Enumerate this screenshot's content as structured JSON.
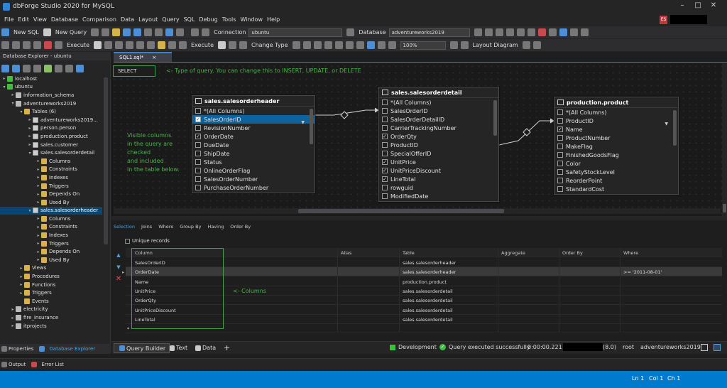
{
  "window": {
    "title": "dbForge Studio 2020 for MySQL",
    "user_badge": "ES"
  },
  "menu": [
    "File",
    "Edit",
    "View",
    "Database",
    "Comparison",
    "Data",
    "Layout",
    "Query",
    "SQL",
    "Debug",
    "Tools",
    "Window",
    "Help"
  ],
  "toolbar1": {
    "new_sql": "New SQL",
    "new_query": "New Query",
    "connection_label": "Connection",
    "connection_value": "ubuntu",
    "database_label": "Database",
    "database_value": "adventureworks2019"
  },
  "toolbar2": {
    "execute1": "Execute",
    "execute2": "Execute",
    "change_type": "Change Type",
    "zoom": "100%",
    "layout_diagram": "Layout Diagram"
  },
  "db_explorer": {
    "header": "Database Explorer - ubuntu",
    "tree": [
      {
        "label": "localhost",
        "indent": 1,
        "icon": "server",
        "exp": "▸"
      },
      {
        "label": "ubuntu",
        "indent": 1,
        "icon": "server",
        "exp": "▾"
      },
      {
        "label": "information_schema",
        "indent": 2,
        "icon": "db",
        "exp": "▸"
      },
      {
        "label": "adventureworks2019",
        "indent": 2,
        "icon": "db",
        "exp": "▾"
      },
      {
        "label": "Tables (6)",
        "indent": 3,
        "icon": "folder",
        "exp": "▾"
      },
      {
        "label": "adventureworks2019...",
        "indent": 4,
        "icon": "table",
        "exp": "▸"
      },
      {
        "label": "person.person",
        "indent": 4,
        "icon": "table",
        "exp": "▸"
      },
      {
        "label": "production.product",
        "indent": 4,
        "icon": "table",
        "exp": "▸"
      },
      {
        "label": "sales.customer",
        "indent": 4,
        "icon": "table",
        "exp": "▸"
      },
      {
        "label": "sales.salesorderdetail",
        "indent": 4,
        "icon": "table",
        "exp": "▾"
      },
      {
        "label": "Columns",
        "indent": 5,
        "icon": "folder",
        "exp": "▸"
      },
      {
        "label": "Constraints",
        "indent": 5,
        "icon": "folder",
        "exp": "▸"
      },
      {
        "label": "Indexes",
        "indent": 5,
        "icon": "folder",
        "exp": "▸"
      },
      {
        "label": "Triggers",
        "indent": 5,
        "icon": "folder",
        "exp": "▸"
      },
      {
        "label": "Depends On",
        "indent": 5,
        "icon": "folder",
        "exp": "▸"
      },
      {
        "label": "Used By",
        "indent": 5,
        "icon": "folder",
        "exp": "▸"
      },
      {
        "label": "sales.salesorderheader",
        "indent": 4,
        "icon": "table",
        "exp": "▾",
        "selected": true
      },
      {
        "label": "Columns",
        "indent": 5,
        "icon": "folder",
        "exp": "▸"
      },
      {
        "label": "Constraints",
        "indent": 5,
        "icon": "folder",
        "exp": "▸"
      },
      {
        "label": "Indexes",
        "indent": 5,
        "icon": "folder",
        "exp": "▸"
      },
      {
        "label": "Triggers",
        "indent": 5,
        "icon": "folder",
        "exp": "▸"
      },
      {
        "label": "Depends On",
        "indent": 5,
        "icon": "folder",
        "exp": "▸"
      },
      {
        "label": "Used By",
        "indent": 5,
        "icon": "folder",
        "exp": "▸"
      },
      {
        "label": "Views",
        "indent": 3,
        "icon": "folder",
        "exp": "▸"
      },
      {
        "label": "Procedures",
        "indent": 3,
        "icon": "folder",
        "exp": "▸"
      },
      {
        "label": "Functions",
        "indent": 3,
        "icon": "folder",
        "exp": "▸"
      },
      {
        "label": "Triggers",
        "indent": 3,
        "icon": "folder",
        "exp": "▸"
      },
      {
        "label": "Events",
        "indent": 3,
        "icon": "folder",
        "exp": ""
      },
      {
        "label": "electricity",
        "indent": 2,
        "icon": "db",
        "exp": "▸"
      },
      {
        "label": "fire_insurance",
        "indent": 2,
        "icon": "db",
        "exp": "▸"
      },
      {
        "label": "itprojects",
        "indent": 2,
        "icon": "db",
        "exp": "▸"
      }
    ],
    "bottom_tabs": {
      "properties": "Properties",
      "explorer": "Database Explorer"
    }
  },
  "doc_tab": {
    "label": "SQL1.sql*",
    "close": "×"
  },
  "query_type": "SELECT",
  "notes": {
    "type_note": "<- Type of query. You can change this to INSERT, UPDATE, or DELETE",
    "visible_note": [
      "Visible columns",
      "in the query are",
      "checked",
      "and included",
      "in the table below."
    ],
    "columns_note": "<- Columns"
  },
  "tables": {
    "header": {
      "title": "sales.salesorderheader",
      "rows": [
        {
          "name": "*(All Columns)",
          "checked": false
        },
        {
          "name": "SalesOrderID",
          "checked": true,
          "selected": true
        },
        {
          "name": "RevisionNumber",
          "checked": false
        },
        {
          "name": "OrderDate",
          "checked": true
        },
        {
          "name": "DueDate",
          "checked": false
        },
        {
          "name": "ShipDate",
          "checked": false
        },
        {
          "name": "Status",
          "checked": false
        },
        {
          "name": "OnlineOrderFlag",
          "checked": false
        },
        {
          "name": "SalesOrderNumber",
          "checked": false
        },
        {
          "name": "PurchaseOrderNumber",
          "checked": false
        }
      ]
    },
    "detail": {
      "title": "sales.salesorderdetail",
      "rows": [
        {
          "name": "*(All Columns)",
          "checked": false
        },
        {
          "name": "SalesOrderID",
          "checked": false
        },
        {
          "name": "SalesOrderDetailID",
          "checked": false
        },
        {
          "name": "CarrierTrackingNumber",
          "checked": false
        },
        {
          "name": "OrderQty",
          "checked": true
        },
        {
          "name": "ProductID",
          "checked": false
        },
        {
          "name": "SpecialOfferID",
          "checked": false
        },
        {
          "name": "UnitPrice",
          "checked": true
        },
        {
          "name": "UnitPriceDiscount",
          "checked": true
        },
        {
          "name": "LineTotal",
          "checked": true
        },
        {
          "name": "rowguid",
          "checked": false
        },
        {
          "name": "ModifiedDate",
          "checked": false
        }
      ]
    },
    "product": {
      "title": "production.product",
      "rows": [
        {
          "name": "*(All Columns)",
          "checked": false
        },
        {
          "name": "ProductID",
          "checked": false
        },
        {
          "name": "Name",
          "checked": true
        },
        {
          "name": "ProductNumber",
          "checked": false
        },
        {
          "name": "MakeFlag",
          "checked": false
        },
        {
          "name": "FinishedGoodsFlag",
          "checked": false
        },
        {
          "name": "Color",
          "checked": false
        },
        {
          "name": "SafetyStockLevel",
          "checked": false
        },
        {
          "name": "ReorderPoint",
          "checked": false
        },
        {
          "name": "StandardCost",
          "checked": false
        }
      ]
    }
  },
  "subtabs": [
    "Selection",
    "Joins",
    "Where",
    "Group By",
    "Having",
    "Order By"
  ],
  "unique_records": "Unique records",
  "grid": {
    "columns": [
      "Column",
      "Alias",
      "Table",
      "Aggregate",
      "Order By",
      "Where"
    ],
    "rows": [
      [
        "SalesOrderID",
        "",
        "sales.salesorderheader",
        "",
        "",
        ""
      ],
      [
        "OrderDate",
        "",
        "sales.salesorderheader",
        "",
        "",
        ">= '2011-08-01'"
      ],
      [
        "Name",
        "",
        "production.product",
        "",
        "",
        ""
      ],
      [
        "UnitPrice",
        "",
        "sales.salesorderdetail",
        "",
        "",
        ""
      ],
      [
        "OrderQty",
        "",
        "sales.salesorderdetail",
        "",
        "",
        ""
      ],
      [
        "UnitPriceDiscount",
        "",
        "sales.salesorderdetail",
        "",
        "",
        ""
      ],
      [
        "LineTotal",
        "",
        "sales.salesorderdetail",
        "",
        "",
        ""
      ]
    ]
  },
  "bottom_tabs": {
    "query_builder": "Query Builder",
    "text": "Text",
    "data": "Data",
    "add": "+"
  },
  "status": {
    "env": "Development",
    "message": "Query executed successfully.",
    "time": "0:00:00.221",
    "version": "(8.0)",
    "user": "root",
    "db": "adventureworks2019"
  },
  "output_bar": {
    "output": "Output",
    "errors": "Error List"
  },
  "statusbar": {
    "ln": "Ln 1",
    "col": "Col 1",
    "ch": "Ch 1"
  },
  "colors": {
    "accent": "#007acc",
    "note": "#4ab34a",
    "check_ok": "#3fbf3f"
  }
}
